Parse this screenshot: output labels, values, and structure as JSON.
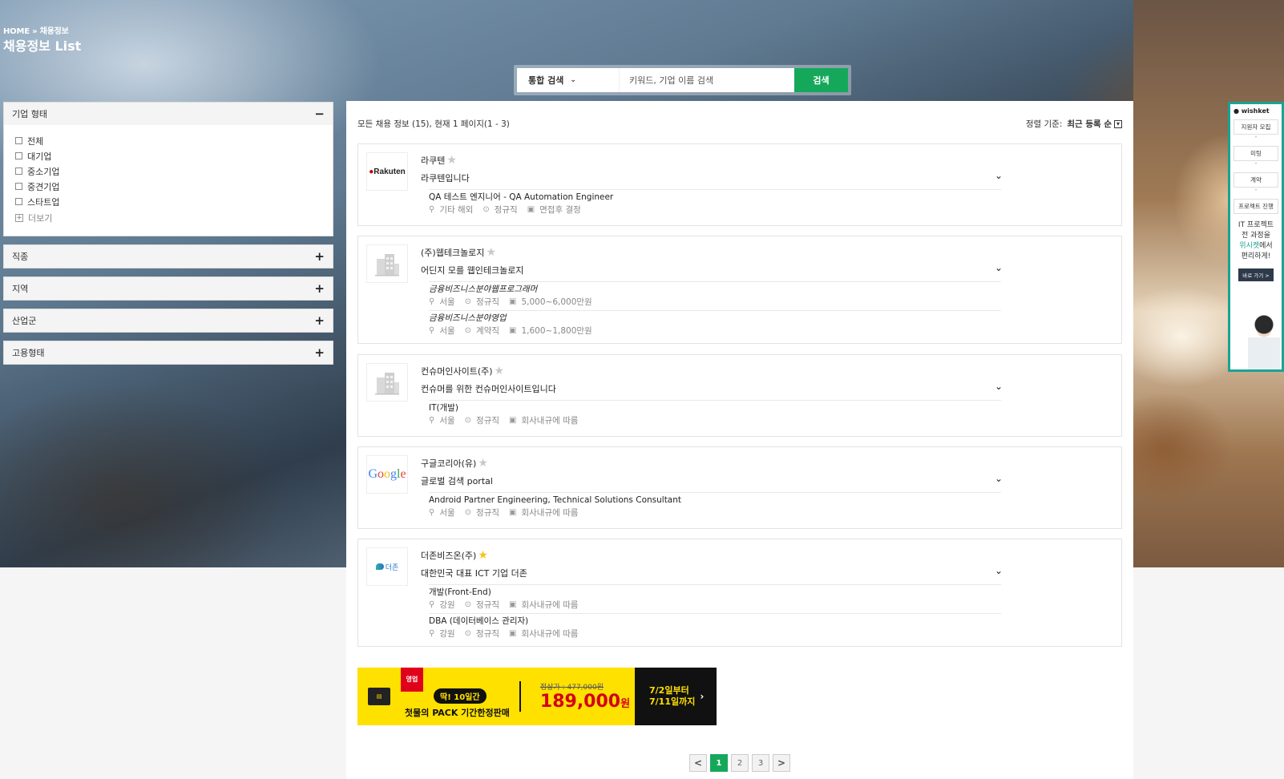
{
  "header": {
    "breadcrumb": "HOME » 채용정보",
    "title": "채용정보 List"
  },
  "search": {
    "scope_label": "통합 검색",
    "placeholder": "키워드, 기업 이름 검색",
    "button_label": "검색"
  },
  "filters": [
    {
      "label": "기업 형태",
      "toggle": "−",
      "expanded": true,
      "options": [
        "전체",
        "대기업",
        "중소기업",
        "중견기업",
        "스타트업"
      ],
      "more_label": "더보기"
    },
    {
      "label": "직종",
      "toggle": "+",
      "expanded": false
    },
    {
      "label": "지역",
      "toggle": "+",
      "expanded": false
    },
    {
      "label": "산업군",
      "toggle": "+",
      "expanded": false
    },
    {
      "label": "고용형태",
      "toggle": "+",
      "expanded": false
    }
  ],
  "list": {
    "summary": "모든 채용 정보 (15), 현재 1 페이지(1 - 3)",
    "sort_label": "정렬 기준:",
    "sort_value": "최근 등록 순"
  },
  "jobs": [
    {
      "logo": "rakuten",
      "logo_text": "Rakuten",
      "company": "라쿠텐",
      "starred": false,
      "description": "라쿠텐입니다",
      "positions": [
        {
          "title": "QA 테스트 엔지니어 - QA Automation Engineer",
          "location": "기타 해외",
          "type": "정규직",
          "salary": "면접후 결정"
        }
      ]
    },
    {
      "logo": "building",
      "company": "(주)웹테크놀로지",
      "starred": false,
      "description": "어딘지 모를 웹인테크놀로지",
      "positions": [
        {
          "title": "금융비즈니스분야웹프로그래머",
          "location": "서울",
          "type": "정규직",
          "salary": "5,000~6,000만원"
        },
        {
          "title": "금융비즈니스분야영업",
          "location": "서울",
          "type": "계약직",
          "salary": "1,600~1,800만원"
        }
      ]
    },
    {
      "logo": "building",
      "company": "컨슈머인사이트(주)",
      "starred": false,
      "description": "컨슈머를 위한 컨슈머인사이트입니다",
      "positions": [
        {
          "title": "IT(개발)",
          "location": "서울",
          "type": "정규직",
          "salary": "회사내규에 따름"
        }
      ]
    },
    {
      "logo": "google",
      "logo_text": "Google",
      "company": "구글코리아(유)",
      "starred": false,
      "description": "글로벌 검색 portal",
      "positions": [
        {
          "title": "Android Partner Engineering, Technical Solutions Consultant",
          "location": "서울",
          "type": "정규직",
          "salary": "회사내규에 따름"
        }
      ]
    },
    {
      "logo": "thezone",
      "logo_text": "더존",
      "company": "더존비즈온(주)",
      "starred": true,
      "description": "대한민국 대표 ICT 기업 더존",
      "positions": [
        {
          "title": "개발(Front-End)",
          "location": "강원",
          "type": "정규직",
          "salary": "회사내규에 따름"
        },
        {
          "title": "DBA (데이터베이스 관리자)",
          "location": "강원",
          "type": "정규직",
          "salary": "회사내규에 따름"
        }
      ]
    }
  ],
  "banner": {
    "ribbon": "영업",
    "pill": "딱! 10일간",
    "pack": "첫물의 PACK 기간한정판매",
    "original_price": "정상가 : 477,000원",
    "sale_price": "189,000",
    "sale_unit": "원",
    "period_line1": "7/2일부터",
    "period_line2": "7/11일까지"
  },
  "pagination": {
    "prev": "<",
    "pages": [
      "1",
      "2",
      "3"
    ],
    "current": "1",
    "next": ">"
  },
  "side_ad": {
    "brand": "wishket",
    "steps": [
      "지원자 모집",
      "미팅",
      "계약",
      "프로젝트 진행"
    ],
    "pitch_line1": "IT 프로젝트",
    "pitch_line2": "전 과정을",
    "pitch_highlight": "위시켓",
    "pitch_line3": "에서",
    "pitch_line4": "편리하게!",
    "cta": "바로 가기 >"
  },
  "colors": {
    "accent": "#15a85b",
    "banner_yellow": "#ffe100",
    "ad_teal": "#1aa394"
  }
}
